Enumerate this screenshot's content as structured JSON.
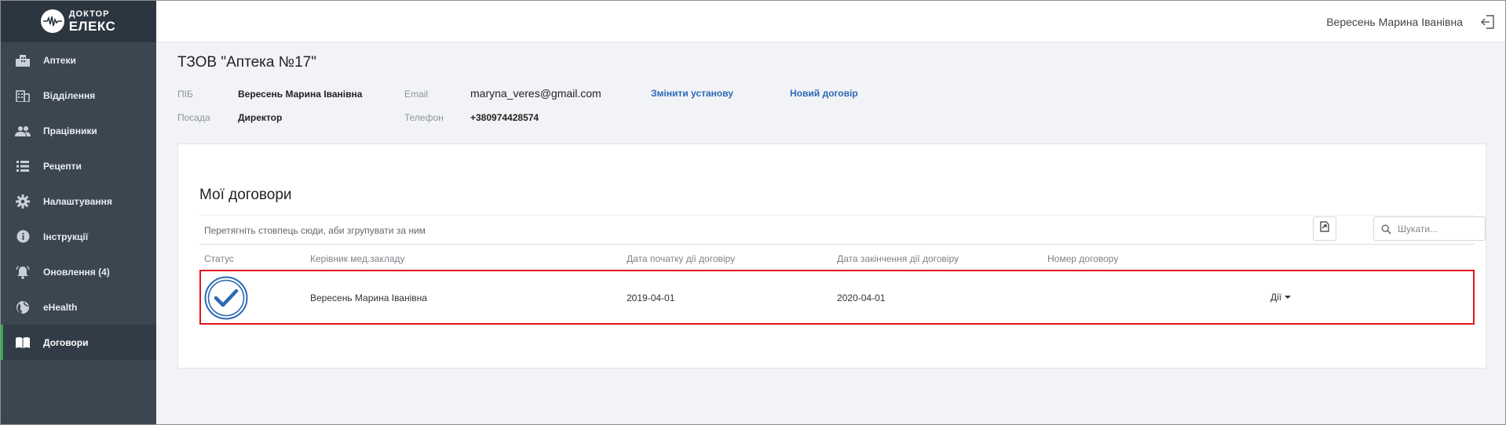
{
  "brand": {
    "line1": "ДОКТОР",
    "line2": "ЕЛЕКС"
  },
  "sidebar": {
    "items": [
      {
        "label": "Аптеки",
        "icon": "building-icon"
      },
      {
        "label": "Відділення",
        "icon": "branch-icon"
      },
      {
        "label": "Працівники",
        "icon": "people-icon"
      },
      {
        "label": "Рецепти",
        "icon": "list-icon"
      },
      {
        "label": "Налаштування",
        "icon": "gear-icon"
      },
      {
        "label": "Інструкції",
        "icon": "info-icon"
      },
      {
        "label": "Оновлення (4)",
        "icon": "bell-icon"
      },
      {
        "label": "eHealth",
        "icon": "globe-icon"
      },
      {
        "label": "Договори",
        "icon": "book-icon",
        "active": true
      }
    ]
  },
  "topbar": {
    "user_name": "Вересень Марина Іванівна"
  },
  "org": {
    "title": "ТЗОВ \"Аптека №17\"",
    "fio_label": "ПІБ",
    "fio_value": "Вересень Марина Іванівна",
    "position_label": "Посада",
    "position_value": "Директор",
    "email_label": "Email",
    "email_value": "maryna_veres@gmail.com",
    "phone_label": "Телефон",
    "phone_value": "+380974428574",
    "change_link": "Змінити установу",
    "new_contract_link": "Новий договір"
  },
  "contracts": {
    "title": "Мої договори",
    "group_hint": "Перетягніть стовпець сюди, аби згрупувати за ним",
    "search_placeholder": "Шукати...",
    "columns": [
      "Статус",
      "Керівник мед.закладу",
      "Дата початку дії договіру",
      "Дата закінчення дії договіру",
      "Номер договору"
    ],
    "rows": [
      {
        "status": "check-circle-icon",
        "manager": "Вересень Марина Іванівна",
        "start": "2019-04-01",
        "end": "2020-04-01",
        "number": "",
        "actions": "Дії"
      }
    ]
  },
  "colors": {
    "sidebar": "#3b4651",
    "accent": "#35a94f",
    "link": "#2b69b5",
    "highlight": "#e1141b",
    "status": "#2b69b5"
  }
}
